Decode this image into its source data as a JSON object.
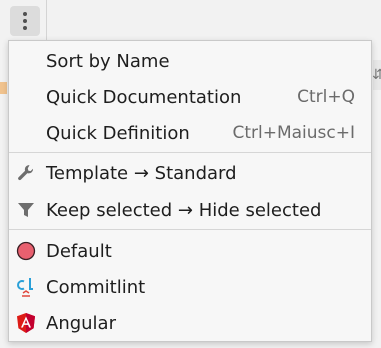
{
  "menu": {
    "items": [
      {
        "label": "Sort by Name",
        "shortcut": "",
        "icon": ""
      },
      {
        "label": "Quick Documentation",
        "shortcut": "Ctrl+Q",
        "icon": ""
      },
      {
        "label": "Quick Definition",
        "shortcut": "Ctrl+Maiusc+I",
        "icon": ""
      },
      {
        "label": "Template → Standard",
        "shortcut": "",
        "icon": "wrench-icon"
      },
      {
        "label": "Keep selected → Hide selected",
        "shortcut": "",
        "icon": "filter-icon"
      },
      {
        "label": "Default",
        "shortcut": "",
        "icon": "circle-icon"
      },
      {
        "label": "Commitlint",
        "shortcut": "",
        "icon": "commitlint-icon"
      },
      {
        "label": "Angular",
        "shortcut": "",
        "icon": "angular-icon"
      }
    ]
  },
  "colors": {
    "default_circle": "#e8606f",
    "angular_red": "#dd1b16",
    "commitlint_blue": "#2aa0d8",
    "commitlint_red": "#e0473c",
    "icon_gray": "#6e6e6e"
  },
  "toolbar": {
    "more_button_icon": "more-vertical-icon"
  }
}
